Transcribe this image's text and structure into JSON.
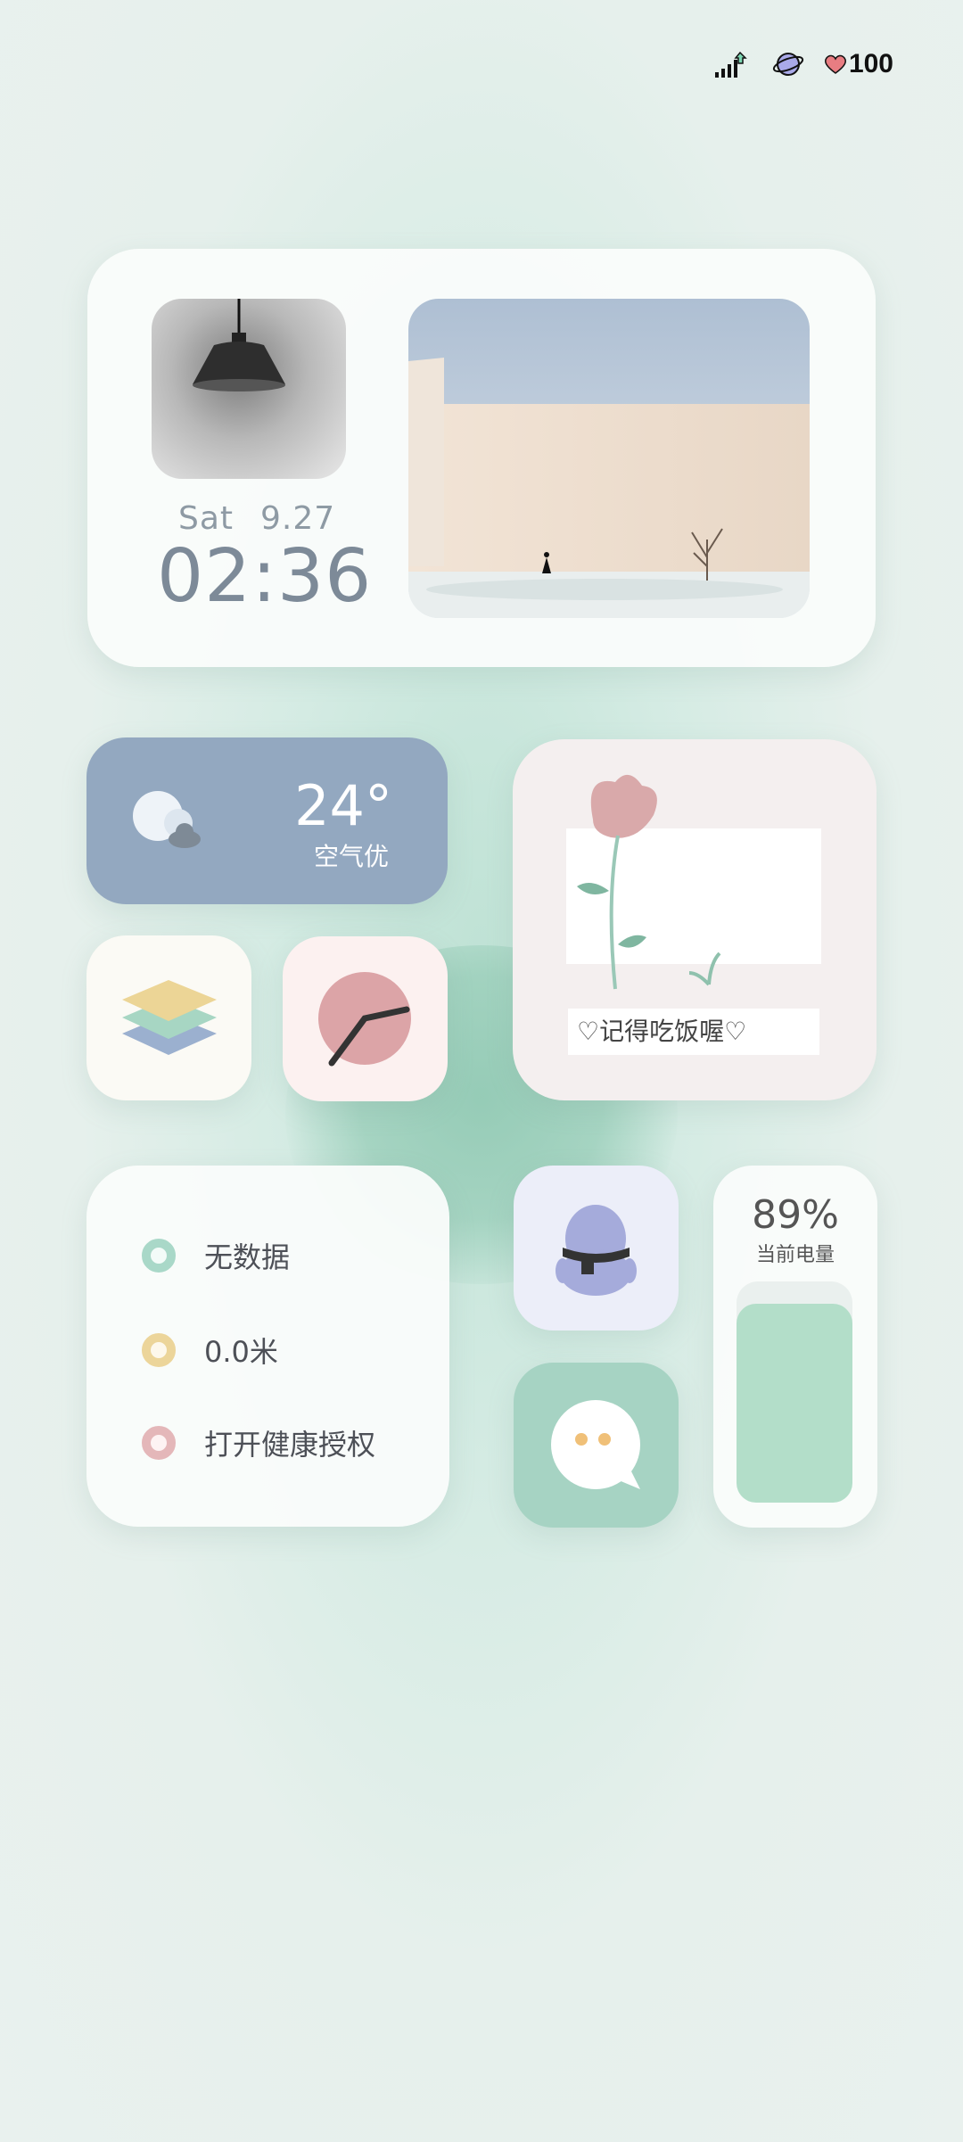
{
  "status_bar": {
    "battery_level": "100"
  },
  "widget_datetime": {
    "weekday": "Sat",
    "date": "9.27",
    "time": "02:36"
  },
  "weather": {
    "temperature": "24°",
    "air_quality": "空气优"
  },
  "flower_note": "♡记得吃饭喔♡",
  "health": {
    "items": [
      {
        "label": "无数据",
        "color": "#a9d8c8"
      },
      {
        "label": "0.0米",
        "color": "#ecd59a"
      },
      {
        "label": "打开健康授权",
        "color": "#e4b7b9"
      }
    ]
  },
  "battery_widget": {
    "percent": "89%",
    "label": "当前电量",
    "level": 0.89
  },
  "colors": {
    "weather_bg": "#93a8c0",
    "chat_bg": "#a6d3c3",
    "qq_bg": "#eceef9"
  }
}
